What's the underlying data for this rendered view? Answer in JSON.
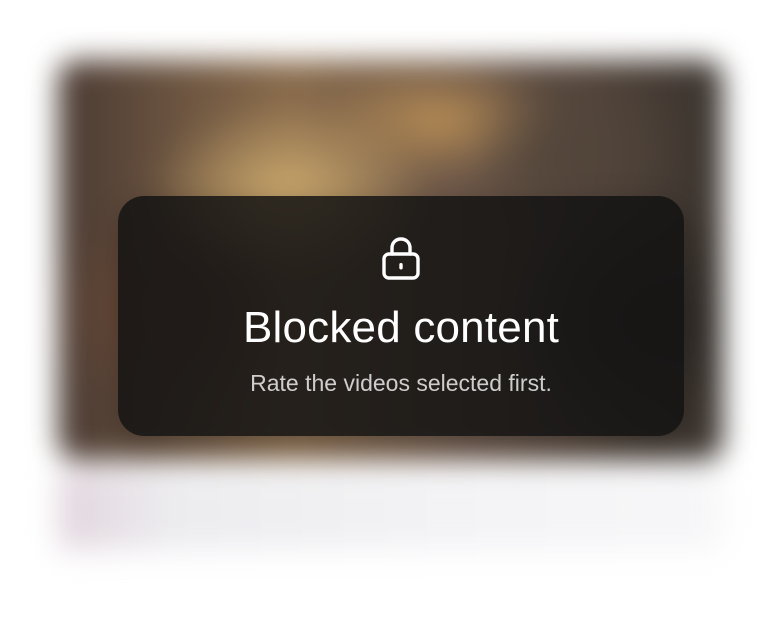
{
  "overlay": {
    "icon": "lock-icon",
    "title": "Blocked content",
    "subtitle": "Rate the videos selected first."
  },
  "colors": {
    "overlay_background": "#121212",
    "title_text": "#ffffff",
    "subtitle_text": "#c7c7c7"
  }
}
